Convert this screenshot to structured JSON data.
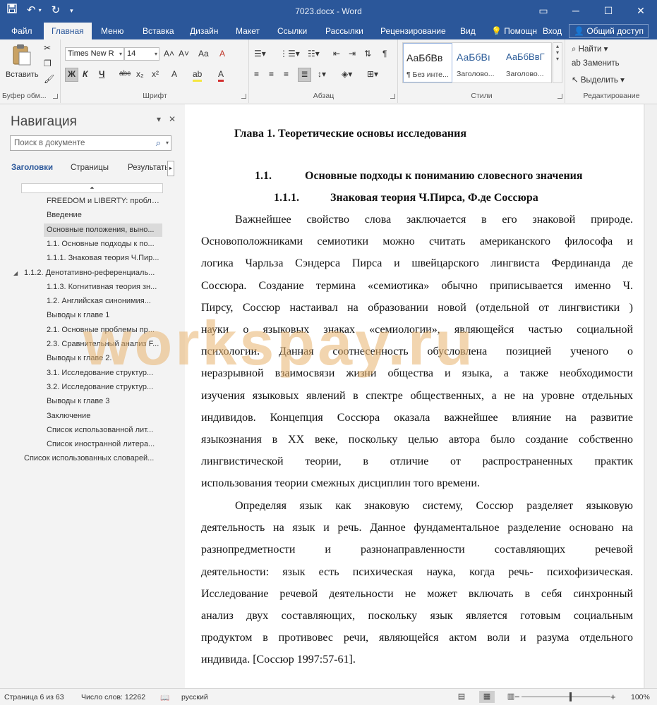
{
  "window": {
    "title": "7023.docx - Word",
    "qat": {
      "save_icon": "save-icon",
      "undo_icon": "undo-icon",
      "redo_icon": "redo-icon"
    },
    "controls": {
      "restore_ribbon": "▭",
      "minimize": "─",
      "maximize": "☐",
      "close": "✕"
    }
  },
  "tabs": {
    "items": [
      "Файл",
      "Главная",
      "Меню",
      "Вставка",
      "Дизайн",
      "Макет",
      "Ссылки",
      "Рассылки",
      "Рецензирование",
      "Вид"
    ],
    "help": "Помощн",
    "signin": "Вход",
    "share": "Общий доступ"
  },
  "ribbon": {
    "clipboard": {
      "label": "Буфер обм...",
      "paste": "Вставить"
    },
    "font": {
      "label": "Шрифт",
      "family": "Times New R",
      "size": "14",
      "bold": "Ж",
      "italic": "К",
      "underline": "Ч",
      "strike": "abc",
      "subscript": "x₂",
      "superscript": "x²",
      "grow": "A˄",
      "shrink": "A˅",
      "case": "Aa",
      "clear": "A",
      "effects": "A",
      "highlight": "ab",
      "color": "A"
    },
    "paragraph": {
      "label": "Абзац",
      "pilcrow": "¶"
    },
    "styles": {
      "label": "Стили",
      "items": [
        {
          "sample": "АаБбВв",
          "name": "¶ Без инте..."
        },
        {
          "sample": "АаБбВı",
          "name": "Заголово..."
        },
        {
          "sample": "АаБбВвГ",
          "name": "Заголово..."
        }
      ]
    },
    "editing": {
      "label": "Редактирование",
      "find": "Найти",
      "replace": "Заменить",
      "select": "Выделить"
    }
  },
  "navigation": {
    "title": "Навигация",
    "search_placeholder": "Поиск в документе",
    "tabs": [
      "Заголовки",
      "Страницы",
      "Результаты"
    ],
    "items": [
      {
        "text": "FREEDOM и LIBERTY: пробле...",
        "level": 3,
        "selected": false,
        "expand": false
      },
      {
        "text": "Введение",
        "level": 3,
        "selected": false,
        "expand": false
      },
      {
        "text": "Основные положения, выно...",
        "level": 3,
        "selected": true,
        "expand": false
      },
      {
        "text": "1.1. Основные подходы к по...",
        "level": 3,
        "selected": false,
        "expand": false
      },
      {
        "text": "1.1.1. Знаковая теория Ч.Пир...",
        "level": 3,
        "selected": false,
        "expand": false
      },
      {
        "text": "1.1.2. Денотативно-референциаль...",
        "level": 2,
        "selected": false,
        "expand": true
      },
      {
        "text": "1.1.3. Когнитивная теория зн...",
        "level": 3,
        "selected": false,
        "expand": false
      },
      {
        "text": "1.2. Английская синонимия...",
        "level": 3,
        "selected": false,
        "expand": false
      },
      {
        "text": "Выводы к главе 1",
        "level": 3,
        "selected": false,
        "expand": false
      },
      {
        "text": "2.1. Основные проблемы пр...",
        "level": 3,
        "selected": false,
        "expand": false
      },
      {
        "text": "2.3. Сравнительный анализ F...",
        "level": 3,
        "selected": false,
        "expand": false
      },
      {
        "text": "Выводы к главе 2.",
        "level": 3,
        "selected": false,
        "expand": false
      },
      {
        "text": "3.1. Исследование структур...",
        "level": 3,
        "selected": false,
        "expand": false
      },
      {
        "text": "3.2. Исследование структур...",
        "level": 3,
        "selected": false,
        "expand": false
      },
      {
        "text": "Выводы к главе 3",
        "level": 3,
        "selected": false,
        "expand": false
      },
      {
        "text": "Заключение",
        "level": 3,
        "selected": false,
        "expand": false
      },
      {
        "text": "Список использованной лит...",
        "level": 3,
        "selected": false,
        "expand": false
      },
      {
        "text": "Список иностранной литера...",
        "level": 3,
        "selected": false,
        "expand": false
      },
      {
        "text": "Список использованных словарей...",
        "level": 2,
        "selected": false,
        "expand": false
      }
    ]
  },
  "document": {
    "chapter": "Глава 1. Теоретические основы исследования",
    "h2_num": "1.1.",
    "h2_text": "Основные подходы к пониманию словесного значения",
    "h3_num": "1.1.1.",
    "h3_text": "Знаковая теория Ч.Пирса, Ф.де Соссюра",
    "p1": [
      "Важнейшее свойство слова заключается в его знаковой природе.",
      "Основоположниками семиотики можно считать американского философа и",
      "логика Чарльза Сэндерса Пирса и швейцарского лингвиста Фердинанда де",
      "Соссюра. Создание термина «семиотика» обычно приписывается именно Ч.",
      "Пирсу, Соссюр настаивал на образовании новой (отдельной от лингвистики )",
      "науки о языковых знаках «семиологии», являющейся частью социальной",
      "психологии. Данная соотнесенность обусловлена позицией ученого о",
      "неразрывной взаимосвязи жизни общества и языка, а также необходимости",
      "изучения языковых явлений в спектре общественных, а не на уровне отдельных",
      "индивидов. Концепция Соссюра оказала важнейшее влияние на развитие",
      "языкознания в XX веке, поскольку целью автора было создание собственно",
      "лингвистической теории, в отличие от распространенных практик",
      "использования теории смежных дисциплин того времени."
    ],
    "p2": [
      "Определяя язык как знаковую систему, Соссюр разделяет языковую",
      "деятельность на язык и речь. Данное фундаментальное разделение основано на",
      "разнопредметности и разнонаправленности составляющих речевой",
      "деятельности: язык есть психическая наука, когда речь- психофизическая.",
      "Исследование речевой деятельности не может включать в себя синхронный",
      "анализ двух составляющих, поскольку язык является готовым социальным",
      "продуктом в противовес речи, являющейся актом воли и разума отдельного",
      "индивида. [Соссюр 1997:57-61]."
    ],
    "watermark": "workspay.ru"
  },
  "status": {
    "page": "Страница 6 из 63",
    "words": "Число слов: 12262",
    "language": "русский",
    "zoom": "100%",
    "zoom_percent": 100
  },
  "colors": {
    "accent": "#2b579a",
    "watermark": "#e8b26e"
  }
}
